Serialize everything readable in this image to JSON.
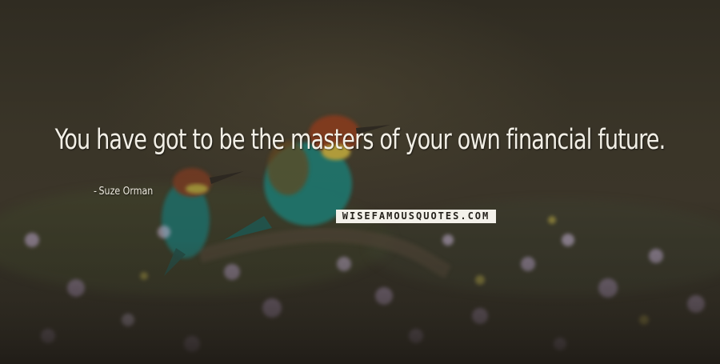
{
  "quote": {
    "text": "You have got to be the masters of your own financial future.",
    "author": "Suze Orman",
    "author_prefix": "-"
  },
  "watermark": {
    "text": "WISEFAMOUSQUOTES.COM"
  },
  "colors": {
    "background": "#3a3528",
    "text": "#f2efe6",
    "watermark_bg": "#f3f1ea"
  }
}
